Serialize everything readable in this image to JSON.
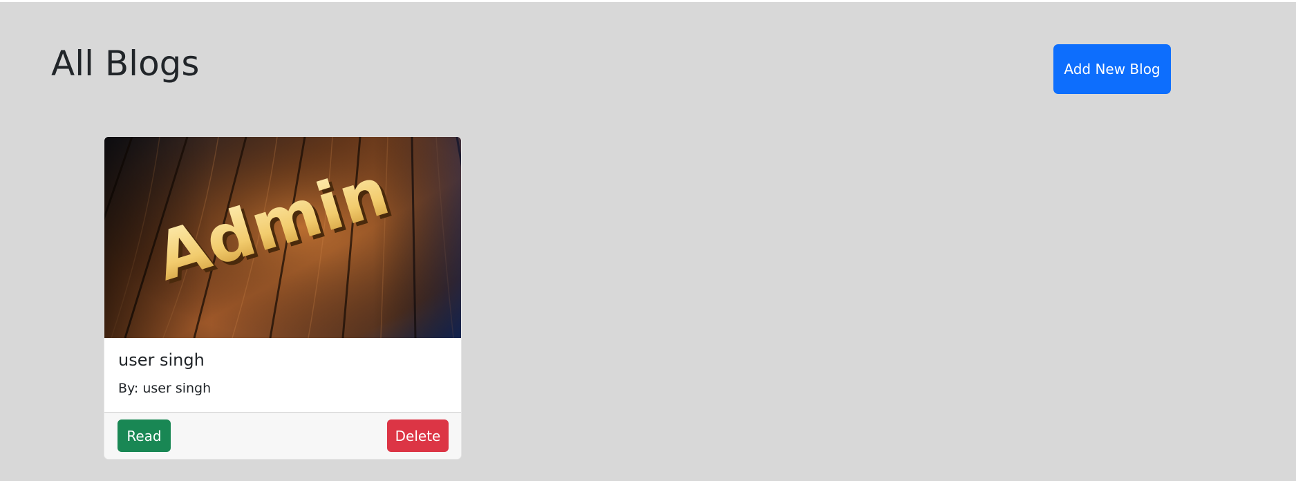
{
  "page": {
    "title": "All Blogs",
    "add_button_label": "Add New Blog"
  },
  "blogs": [
    {
      "image_word": "Admin",
      "title": "user singh",
      "author": "By: user singh",
      "read_label": "Read",
      "delete_label": "Delete"
    }
  ],
  "colors": {
    "background": "#d8d8d8",
    "primary": "#0d6efd",
    "success": "#198754",
    "danger": "#dc3545"
  }
}
